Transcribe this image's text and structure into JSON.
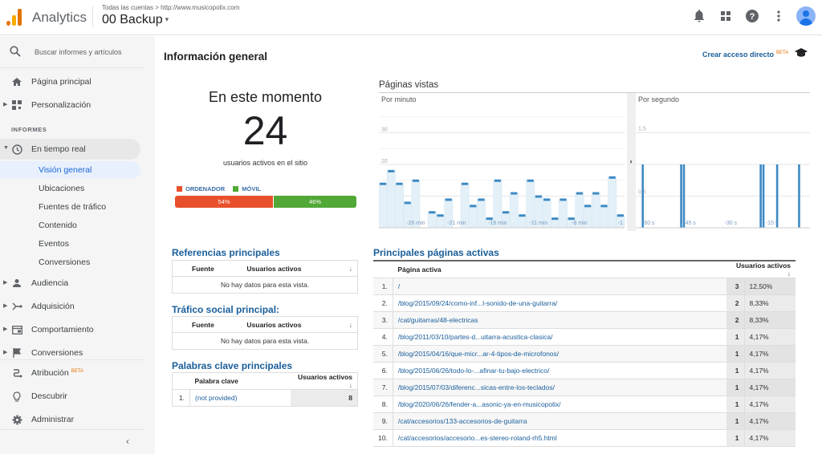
{
  "topbar": {
    "app_name": "Analytics",
    "breadcrumb": "Todas las cuentas > http://www.musicopolix.com",
    "account": "00 Backup",
    "caret": "▾",
    "icons": [
      "bell-icon",
      "apps-grid-icon",
      "help-icon",
      "more-vert-icon",
      "account-avatar"
    ]
  },
  "sidebar": {
    "search_placeholder": "Buscar informes y artículos",
    "section_label": "INFORMES",
    "items": [
      {
        "label": "Página principal",
        "icon": "home-icon"
      },
      {
        "label": "Personalización",
        "icon": "dashboard-icon"
      },
      {
        "label": "En tiempo real",
        "icon": "clock-icon"
      },
      {
        "label": "Audiencia",
        "icon": "person-icon"
      },
      {
        "label": "Adquisición",
        "icon": "acquisition-icon"
      },
      {
        "label": "Comportamiento",
        "icon": "behavior-icon"
      },
      {
        "label": "Conversiones",
        "icon": "flag-icon"
      },
      {
        "label": "Atribución",
        "icon": "attribution-icon",
        "badge": "BETA"
      },
      {
        "label": "Descubrir",
        "icon": "lightbulb-icon"
      },
      {
        "label": "Administrar",
        "icon": "gear-icon"
      }
    ],
    "realtime_sub": [
      "Visión general",
      "Ubicaciones",
      "Fuentes de tráfico",
      "Contenido",
      "Eventos",
      "Conversiones"
    ],
    "selected_sub": "Visión general"
  },
  "main": {
    "title": "Información general",
    "shortcut_label": "Crear acceso directo",
    "shortcut_badge": "BETA",
    "now": {
      "title": "En este momento",
      "value": "24",
      "subtitle": "usuarios activos en el sitio"
    },
    "devices": {
      "legend": [
        {
          "label": "ORDENADOR",
          "color": "#e8502b"
        },
        {
          "label": "MÓVIL",
          "color": "#51a836"
        }
      ],
      "split": [
        {
          "label": "54%",
          "value": 54,
          "color": "#e8502b"
        },
        {
          "label": "46%",
          "value": 46,
          "color": "#51a836"
        }
      ]
    },
    "pageviews_title": "Páginas vistas",
    "referrals": {
      "title": "Referencias principales",
      "headers": [
        "Fuente",
        "Usuarios activos"
      ],
      "empty": "No hay datos para esta vista."
    },
    "social": {
      "title": "Tráfico social principal:",
      "headers": [
        "Fuente",
        "Usuarios activos"
      ],
      "empty": "No hay datos para esta vista."
    },
    "keywords": {
      "title": "Palabras clave principales",
      "headers": [
        "Palabra clave",
        "Usuarios activos"
      ],
      "rows": [
        {
          "n": "1.",
          "keyword": "(not provided)",
          "value": "8"
        }
      ]
    },
    "pages": {
      "title": "Principales páginas activas",
      "headers": [
        "Página activa",
        "Usuarios activos"
      ],
      "rows": [
        {
          "n": "1.",
          "page": "/",
          "value": "3",
          "pct": "12,50%"
        },
        {
          "n": "2.",
          "page": "/blog/2015/09/24/como-inf...l-sonido-de-una-guitarra/",
          "value": "2",
          "pct": "8,33%"
        },
        {
          "n": "3.",
          "page": "/cat/guitarras/48-electricas",
          "value": "2",
          "pct": "8,33%"
        },
        {
          "n": "4.",
          "page": "/blog/2011/03/10/partes-d...uitarra-acustica-clasica/",
          "value": "1",
          "pct": "4,17%"
        },
        {
          "n": "5.",
          "page": "/blog/2015/04/16/que-micr...ar-4-tipos-de-microfonos/",
          "value": "1",
          "pct": "4,17%"
        },
        {
          "n": "6.",
          "page": "/blog/2015/06/26/todo-lo-...afinar-tu-bajo-electrico/",
          "value": "1",
          "pct": "4,17%"
        },
        {
          "n": "7.",
          "page": "/blog/2015/07/03/diferenc...sicas-entre-los-teclados/",
          "value": "1",
          "pct": "4,17%"
        },
        {
          "n": "8.",
          "page": "/blog/2020/06/26/fender-a...asonic-ya-en-musicopolix/",
          "value": "1",
          "pct": "4,17%"
        },
        {
          "n": "9.",
          "page": "/cat/accesorios/133-accesorios-de-guitarra",
          "value": "1",
          "pct": "4,17%"
        },
        {
          "n": "10.",
          "page": "/cat/accesorios/accesorio...es-stereo-roland-rh5.html",
          "value": "1",
          "pct": "4,17%"
        }
      ]
    }
  },
  "chart_data": [
    {
      "type": "bar",
      "title": "Por minuto",
      "ylim": [
        0,
        40
      ],
      "yticks": [
        "10",
        "20",
        "30"
      ],
      "xticks": [
        "-26 min",
        "-21 min",
        "-16 min",
        "-11 min",
        "-6 min",
        "-1"
      ],
      "values": [
        14,
        18,
        14,
        8,
        15,
        0,
        5,
        4,
        9,
        0,
        14,
        7,
        9,
        3,
        15,
        5,
        11,
        4,
        15,
        10,
        9,
        3,
        9,
        3,
        11,
        7,
        11,
        7,
        16,
        4
      ],
      "color": "#3d8ac4"
    },
    {
      "type": "bar",
      "title": "Por segundo",
      "ylim": [
        0,
        2
      ],
      "yticks": [
        "0,5",
        "1,5"
      ],
      "xticks": [
        "-60 s",
        "-45 s",
        "-30 s",
        "-15 s"
      ],
      "spikes_seconds_ago": [
        59,
        45,
        44,
        16,
        15,
        10,
        2
      ],
      "spike_value": 1,
      "color": "#3d8ac4"
    }
  ]
}
